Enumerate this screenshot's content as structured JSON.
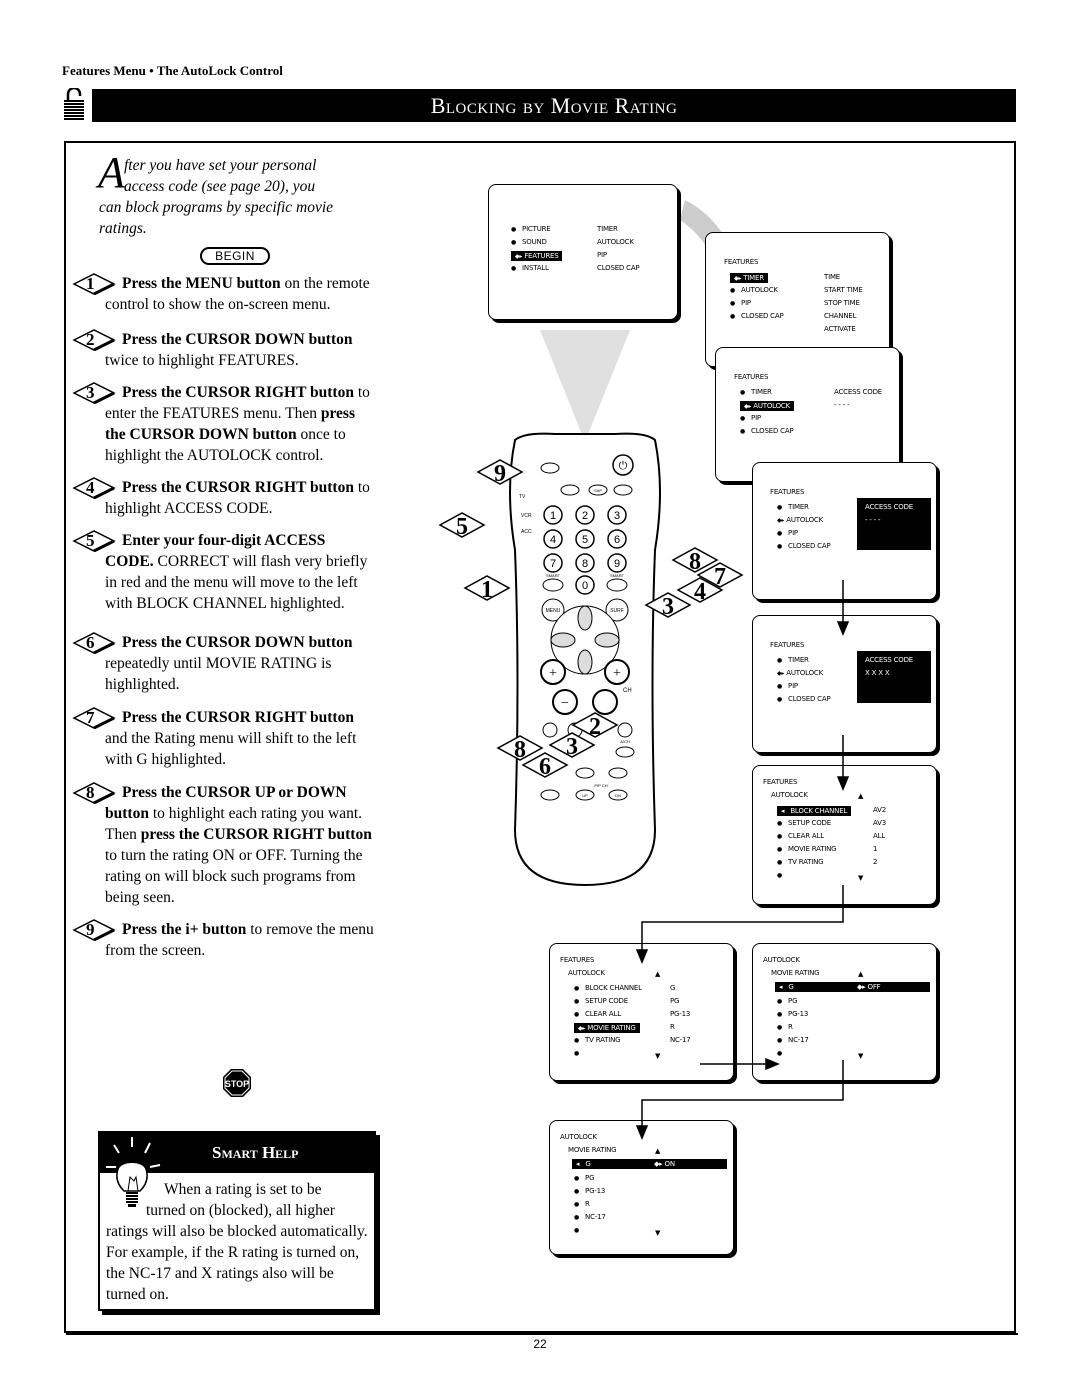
{
  "header": {
    "section": "Features Menu • The AutoLock Control",
    "title": "Blocking by Movie Rating"
  },
  "intro": {
    "dropcap": "A",
    "line1": "fter you have set your personal",
    "line2": "access code (see page 20), you",
    "rest": "can block programs by specific movie ratings."
  },
  "begin_label": "BEGIN",
  "steps": [
    {
      "n": "1",
      "bold": "Press the MENU button",
      "text": " on the remote control to show the on-screen menu."
    },
    {
      "n": "2",
      "bold": "Press the CURSOR DOWN button",
      "text": " twice to highlight FEATURES."
    },
    {
      "n": "3",
      "bold": "Press the CURSOR RIGHT button",
      "text": " to enter the FEATURES menu. Then ",
      "bold2": "press the CURSOR DOWN button",
      "text2": " once to highlight the AUTOLOCK control."
    },
    {
      "n": "4",
      "bold": "Press the CURSOR RIGHT button",
      "text": " to highlight ACCESS CODE."
    },
    {
      "n": "5",
      "bold": "Enter your four-digit ACCESS CODE.",
      "text": " CORRECT will flash very briefly in red and the menu will move to the left with BLOCK CHANNEL highlighted."
    },
    {
      "n": "6",
      "bold": "Press the CURSOR DOWN button",
      "text": " repeatedly until MOVIE RATING is highlighted."
    },
    {
      "n": "7",
      "bold": "Press the CURSOR RIGHT button",
      "text": " and the Rating menu will shift to the left with G highlighted."
    },
    {
      "n": "8",
      "bold": "Press the CURSOR UP or DOWN button",
      "text": " to highlight each rating you want. Then ",
      "bold2": "press the CURSOR RIGHT button",
      "text2": " to turn the rating ON or OFF. Turning the rating on will block such programs from being seen."
    },
    {
      "n": "9",
      "bold": "Press the i+ button",
      "text": " to remove the menu from the screen."
    }
  ],
  "stop_label": "STOP",
  "smart_help": {
    "title": "Smart Help",
    "line1": "When a rating is set to be",
    "line2": "turned on (blocked), all higher",
    "rest": "ratings will also be blocked automatically. For example, if the R rating is turned on, the NC-17 and X ratings also will be turned on."
  },
  "remote": {
    "buttons": [
      "1",
      "2",
      "3",
      "4",
      "5",
      "6",
      "7",
      "8",
      "9",
      "0"
    ],
    "labels": {
      "menu": "MENU",
      "surf": "SURF",
      "sap": "SAP",
      "ch": "CH",
      "pipch": "PIP CH",
      "up": "UP",
      "dn": "DN",
      "smart": "SMART",
      "tv": "TV",
      "vcr": "VCR",
      "acc": "ACC",
      "ach": "A/CH"
    },
    "callouts": [
      "9",
      "5",
      "1",
      "8",
      "7",
      "4",
      "3",
      "2",
      "3",
      "8",
      "6"
    ]
  },
  "screens": {
    "main": {
      "left": [
        "PICTURE",
        "SOUND",
        "FEATURES",
        "INSTALL"
      ],
      "right": [
        "TIMER",
        "AUTOLOCK",
        "PIP",
        "CLOSED CAP"
      ],
      "selected": 2
    },
    "features_timer": {
      "title": "FEATURES",
      "left": [
        "TIMER",
        "AUTOLOCK",
        "PIP",
        "CLOSED CAP"
      ],
      "right": [
        "TIME",
        "START TIME",
        "STOP TIME",
        "CHANNEL",
        "ACTIVATE"
      ],
      "selected": 0
    },
    "features_autolock": {
      "title": "FEATURES",
      "left": [
        "TIMER",
        "AUTOLOCK",
        "PIP",
        "CLOSED CAP"
      ],
      "code_label": "ACCESS CODE",
      "code_value": "- - - -",
      "selected": 1
    },
    "access_code_box": {
      "title": "FEATURES",
      "left": [
        "TIMER",
        "AUTOLOCK",
        "PIP",
        "CLOSED CAP"
      ],
      "code_label": "ACCESS CODE",
      "code_value": "- - - -"
    },
    "access_code_entered": {
      "title": "FEATURES",
      "left": [
        "TIMER",
        "AUTOLOCK",
        "PIP",
        "CLOSED CAP"
      ],
      "code_label": "ACCESS CODE",
      "code_value": "X X X X"
    },
    "autolock_block": {
      "title": "FEATURES",
      "subtitle": "AUTOLOCK",
      "left": [
        "BLOCK CHANNEL",
        "SETUP CODE",
        "CLEAR ALL",
        "MOVIE RATING",
        "TV RATING"
      ],
      "right": [
        "AV2",
        "AV3",
        "ALL",
        "1",
        "2"
      ]
    },
    "autolock_movie": {
      "title": "FEATURES",
      "subtitle": "AUTOLOCK",
      "left": [
        "BLOCK CHANNEL",
        "SETUP CODE",
        "CLEAR ALL",
        "MOVIE RATING",
        "TV RATING"
      ],
      "right": [
        "G",
        "PG",
        "PG-13",
        "R",
        "NC-17"
      ]
    },
    "rating_off": {
      "title": "AUTOLOCK",
      "subtitle": "MOVIE RATING",
      "ratings": [
        "G",
        "PG",
        "PG-13",
        "R",
        "NC-17"
      ],
      "state": "OFF"
    },
    "rating_on": {
      "title": "AUTOLOCK",
      "subtitle": "MOVIE RATING",
      "ratings": [
        "G",
        "PG",
        "PG-13",
        "R",
        "NC-17"
      ],
      "state": "ON"
    }
  },
  "page_number": "22"
}
